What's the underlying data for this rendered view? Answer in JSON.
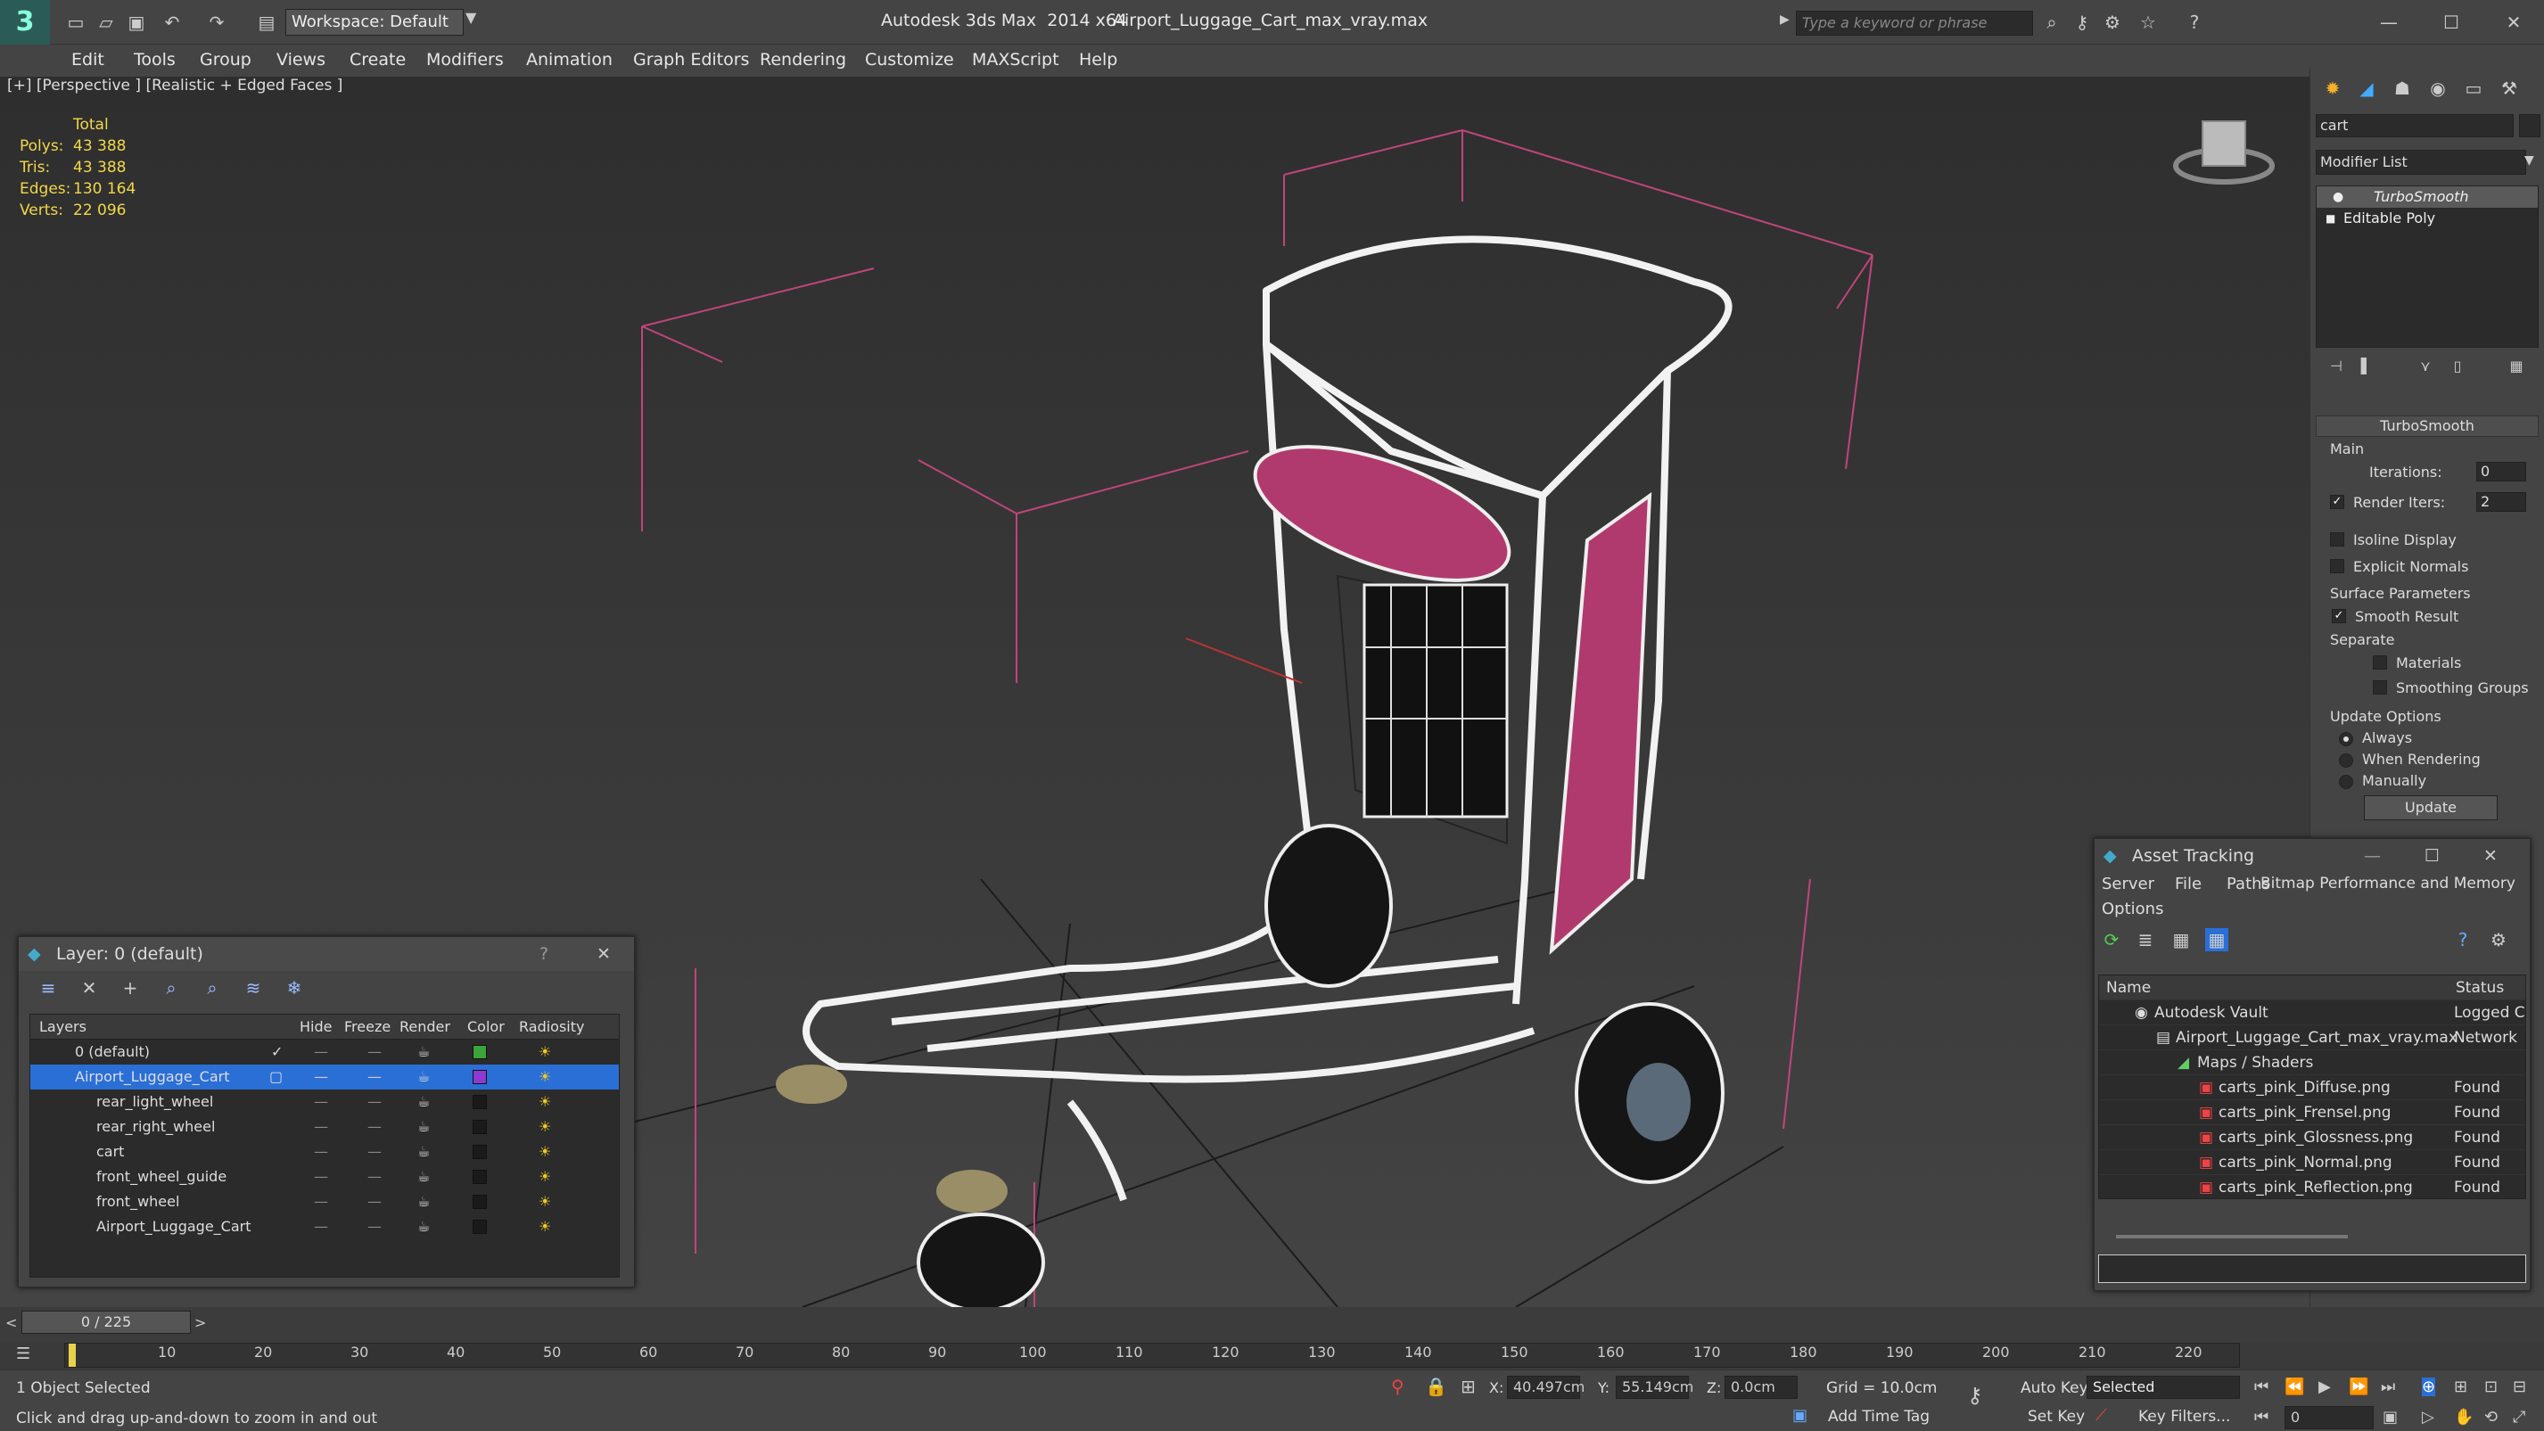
{
  "titlebar": {
    "app_title": "Autodesk 3ds Max  2014 x64",
    "file_name": "Airport_Luggage_Cart_max_vray.max",
    "workspace": "Workspace: Default",
    "search_placeholder": "Type a keyword or phrase"
  },
  "menu": [
    "Edit",
    "Tools",
    "Group",
    "Views",
    "Create",
    "Modifiers",
    "Animation",
    "Graph Editors",
    "Rendering",
    "Customize",
    "MAXScript",
    "Help"
  ],
  "viewport": {
    "label": "[+] [Perspective ] [Realistic + Edged Faces ]",
    "stats_header": "Total",
    "stats": [
      {
        "label": "Polys:",
        "value": "43 388"
      },
      {
        "label": "Tris:",
        "value": "43 388"
      },
      {
        "label": "Edges:",
        "value": "130 164"
      },
      {
        "label": "Verts:",
        "value": "22 096"
      }
    ]
  },
  "command_panel": {
    "object_name": "cart",
    "modifier_list": "Modifier List",
    "stack": [
      "TurboSmooth",
      "Editable Poly"
    ],
    "rollout_title": "TurboSmooth",
    "main_label": "Main",
    "iterations_label": "Iterations:",
    "iterations_value": "0",
    "render_iters_label": "Render Iters:",
    "render_iters_value": "2",
    "isoline": "Isoline Display",
    "explicit_normals": "Explicit Normals",
    "surface_params": "Surface Parameters",
    "smooth_result": "Smooth Result",
    "separate": "Separate",
    "materials": "Materials",
    "smoothing_groups": "Smoothing Groups",
    "update_options": "Update Options",
    "always": "Always",
    "when_rendering": "When Rendering",
    "manually": "Manually",
    "update_button": "Update"
  },
  "layer_panel": {
    "title": "Layer: 0 (default)",
    "help": "?",
    "columns": [
      "Layers",
      "Hide",
      "Freeze",
      "Render",
      "Color",
      "Radiosity"
    ],
    "rows": [
      {
        "name": "0 (default)",
        "color": "#3aa53a"
      },
      {
        "name": "Airport_Luggage_Cart",
        "color": "#8e3ad0"
      },
      {
        "name": "rear_light_wheel",
        "color": "#1a1a1a"
      },
      {
        "name": "rear_right_wheel",
        "color": "#1a1a1a"
      },
      {
        "name": "cart",
        "color": "#1a1a1a"
      },
      {
        "name": "front_wheel_guide",
        "color": "#1a1a1a"
      },
      {
        "name": "front_wheel",
        "color": "#1a1a1a"
      },
      {
        "name": "Airport_Luggage_Cart",
        "color": "#1a1a1a"
      }
    ]
  },
  "asset_panel": {
    "title": "Asset Tracking",
    "menus": [
      "Server",
      "File",
      "Paths",
      "Bitmap Performance and Memory",
      "Options"
    ],
    "col_name": "Name",
    "col_status": "Status",
    "rows": [
      {
        "name": "Autodesk Vault",
        "status": "Logged C"
      },
      {
        "name": "Airport_Luggage_Cart_max_vray.max",
        "status": "Network"
      },
      {
        "name": "Maps / Shaders",
        "status": ""
      },
      {
        "name": "carts_pink_Diffuse.png",
        "status": "Found"
      },
      {
        "name": "carts_pink_Frensel.png",
        "status": "Found"
      },
      {
        "name": "carts_pink_Glossness.png",
        "status": "Found"
      },
      {
        "name": "carts_pink_Normal.png",
        "status": "Found"
      },
      {
        "name": "carts_pink_Reflection.png",
        "status": "Found"
      }
    ]
  },
  "timeline": {
    "frame": "0 / 225",
    "ticks": [
      "0",
      "10",
      "20",
      "30",
      "40",
      "50",
      "60",
      "70",
      "80",
      "90",
      "100",
      "110",
      "120",
      "130",
      "140",
      "150",
      "160",
      "170",
      "180",
      "190",
      "200",
      "210",
      "220"
    ]
  },
  "status": {
    "selection": "1 Object Selected",
    "prompt": "Click and drag up-and-down to zoom in and out",
    "x_label": "X:",
    "x": "40.497cm",
    "y_label": "Y:",
    "y": "55.149cm",
    "z_label": "Z:",
    "z": "0.0cm",
    "grid": "Grid = 10.0cm",
    "add_time_tag": "Add Time Tag",
    "auto_key": "Auto Key",
    "set_key": "Set Key",
    "selected": "Selected",
    "key_filters": "Key Filters...",
    "frame_field": "0"
  },
  "colors": {
    "accent": "#2a6fd6",
    "wire_pink": "#c0457a",
    "stats_yellow": "#f0d84a"
  }
}
